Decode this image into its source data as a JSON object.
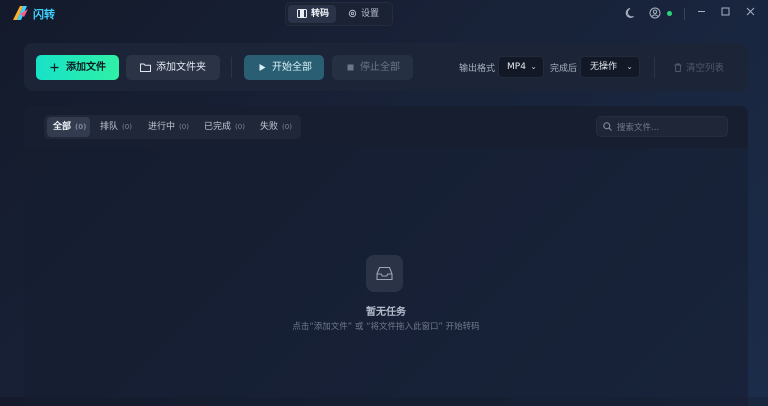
{
  "app": {
    "title": "闪转"
  },
  "nav": {
    "tabs": [
      {
        "label": "转码",
        "active": true
      },
      {
        "label": "设置",
        "active": false
      }
    ]
  },
  "toolbar": {
    "add_file": "添加文件",
    "add_folder": "添加文件夹",
    "start_all": "开始全部",
    "stop_all": "停止全部",
    "output_format_label": "输出格式",
    "output_format_value": "MP4",
    "after_done_label": "完成后",
    "after_done_value": "无操作",
    "clear_list": "清空列表"
  },
  "filters": [
    {
      "label": "全部",
      "count": "(0)",
      "active": true
    },
    {
      "label": "排队",
      "count": "(0)"
    },
    {
      "label": "进行中",
      "count": "(0)"
    },
    {
      "label": "已完成",
      "count": "(0)"
    },
    {
      "label": "失败",
      "count": "(0)"
    }
  ],
  "search": {
    "placeholder": "搜索文件..."
  },
  "empty": {
    "title": "暂无任务",
    "subtitle": "点击“添加文件” 或 “将文件拖入此窗口” 开始转码"
  },
  "colors": {
    "accent": "#2ff0a6",
    "brand": "#3fd0ff",
    "status_online": "#2ad47a"
  },
  "icons": [
    "app-logo-icon",
    "film-icon",
    "gear-icon",
    "moon-icon",
    "user-icon",
    "minimize-icon",
    "maximize-icon",
    "close-icon",
    "plus-icon",
    "folder-icon",
    "play-icon",
    "stop-icon",
    "trash-icon",
    "search-icon",
    "inbox-icon"
  ]
}
